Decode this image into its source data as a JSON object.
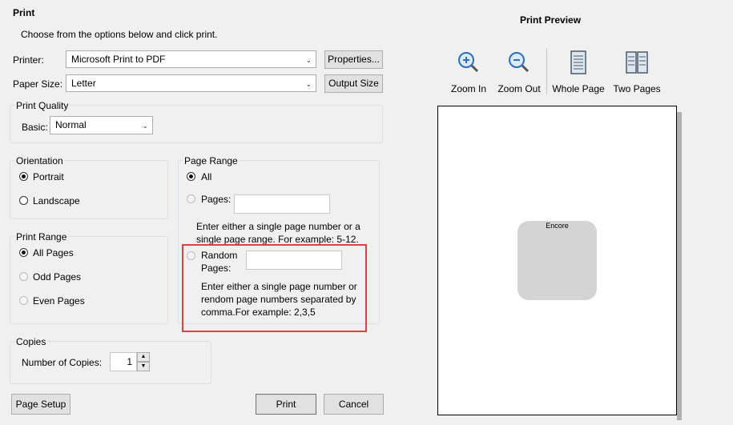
{
  "dialog": {
    "title": "Print",
    "subtitle": "Choose from the options below and click print."
  },
  "printer": {
    "label": "Printer:",
    "value": "Microsoft Print to PDF",
    "properties_button": "Properties..."
  },
  "paper": {
    "label": "Paper Size:",
    "value": "Letter",
    "output_size_button": "Output Size"
  },
  "print_quality": {
    "title": "Print Quality",
    "basic_label": "Basic:",
    "value": "Normal"
  },
  "orientation": {
    "title": "Orientation",
    "options": [
      {
        "label": "Portrait",
        "checked": true
      },
      {
        "label": "Landscape",
        "checked": false
      }
    ]
  },
  "print_range": {
    "title": "Print Range",
    "options": [
      {
        "label": "All Pages",
        "checked": true,
        "enabled": true
      },
      {
        "label": "Odd Pages",
        "checked": false,
        "enabled": false
      },
      {
        "label": "Even Pages",
        "checked": false,
        "enabled": false
      }
    ]
  },
  "page_range": {
    "title": "Page Range",
    "all_label": "All",
    "pages_label": "Pages:",
    "pages_value": "",
    "pages_help_line1": "Enter either a single page number or a",
    "pages_help_line2": "single page range. For example: 5-12.",
    "random_label_line1": "Random",
    "random_label_line2": "Pages:",
    "random_value": "",
    "random_help_line1": "Enter either a single page number or",
    "random_help_line2": "rendom page numbers separated by",
    "random_help_line3": "comma.For example: 2,3,5"
  },
  "copies": {
    "title": "Copies",
    "label": "Number of Copies:",
    "value": "1"
  },
  "footer": {
    "page_setup": "Page Setup",
    "print": "Print",
    "cancel": "Cancel"
  },
  "preview": {
    "title": "Print Preview",
    "tools": [
      {
        "label": "Zoom In",
        "icon": "zoom-in-icon"
      },
      {
        "label": "Zoom Out",
        "icon": "zoom-out-icon"
      },
      {
        "label": "Whole Page",
        "icon": "whole-page-icon"
      },
      {
        "label": "Two Pages",
        "icon": "two-pages-icon"
      }
    ],
    "logo_text": "Encore"
  },
  "colors": {
    "accent_red": "#e04040",
    "zoom_blue": "#2a6fc0"
  }
}
